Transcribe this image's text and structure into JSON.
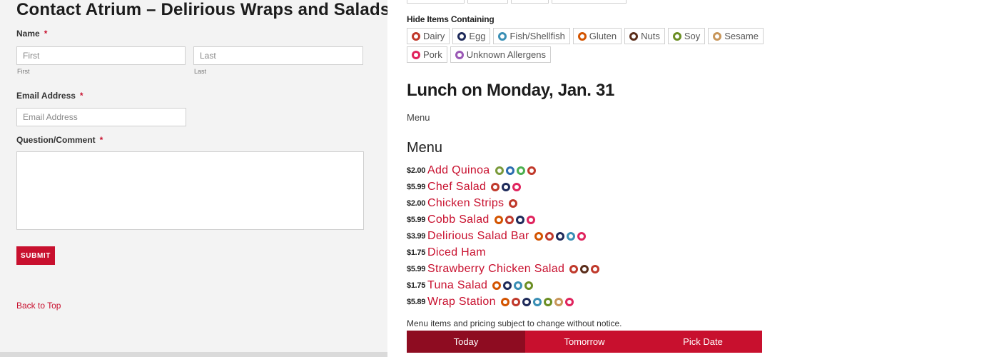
{
  "contact": {
    "title": "Contact Atrium – Delirious Wraps and Salads",
    "name_label": "Name",
    "required_mark": "*",
    "first_placeholder": "First",
    "first_sub": "First",
    "last_placeholder": "Last",
    "last_sub": "Last",
    "email_label": "Email Address",
    "email_placeholder": "Email Address",
    "question_label": "Question/Comment",
    "submit_label": "SUBMIT",
    "back_to_top": "Back to Top"
  },
  "filters": {
    "title": "Hide Items Containing",
    "allergens": [
      {
        "label": "Dairy",
        "color": "#c0392b"
      },
      {
        "label": "Egg",
        "color": "#1e2a5a"
      },
      {
        "label": "Fish/Shellfish",
        "color": "#3a8fb5"
      },
      {
        "label": "Gluten",
        "color": "#d35400"
      },
      {
        "label": "Nuts",
        "color": "#5a2d1a"
      },
      {
        "label": "Soy",
        "color": "#6b8e23"
      },
      {
        "label": "Sesame",
        "color": "#c8965a"
      },
      {
        "label": "Pork",
        "color": "#e0245e"
      },
      {
        "label": "Unknown Allergens",
        "color": "#9b59b6"
      }
    ]
  },
  "menu": {
    "day_title": "Lunch on Monday, Jan. 31",
    "menu_link": "Menu",
    "heading": "Menu",
    "items": [
      {
        "price": "$2.00",
        "name": "Add Quinoa",
        "icons": [
          "#7a9a3a",
          "#2b6cb0",
          "#4caf50",
          "#c0392b"
        ]
      },
      {
        "price": "$5.99",
        "name": "Chef Salad",
        "icons": [
          "#c0392b",
          "#1e2a5a",
          "#e0245e"
        ]
      },
      {
        "price": "$2.00",
        "name": "Chicken Strips",
        "icons": [
          "#c0392b"
        ]
      },
      {
        "price": "$5.99",
        "name": "Cobb Salad",
        "icons": [
          "#d35400",
          "#c0392b",
          "#1e2a5a",
          "#e0245e"
        ]
      },
      {
        "price": "$3.99",
        "name": "Delirious Salad Bar",
        "icons": [
          "#d35400",
          "#c0392b",
          "#1e2a5a",
          "#3a8fb5",
          "#e0245e"
        ]
      },
      {
        "price": "$1.75",
        "name": "Diced Ham",
        "icons": []
      },
      {
        "price": "$5.99",
        "name": "Strawberry Chicken Salad",
        "icons": [
          "#c0392b",
          "#5a2d1a",
          "#c0392b"
        ]
      },
      {
        "price": "$1.75",
        "name": "Tuna Salad",
        "icons": [
          "#d35400",
          "#1e2a5a",
          "#3a8fb5",
          "#6b8e23"
        ]
      },
      {
        "price": "$5.89",
        "name": "Wrap Station",
        "icons": [
          "#d35400",
          "#c0392b",
          "#1e2a5a",
          "#3a8fb5",
          "#6b8e23",
          "#c8965a",
          "#e0245e"
        ]
      }
    ],
    "notice": "Menu items and pricing subject to change without notice."
  },
  "datebar": {
    "today": "Today",
    "tomorrow": "Tomorrow",
    "pick": "Pick Date"
  }
}
